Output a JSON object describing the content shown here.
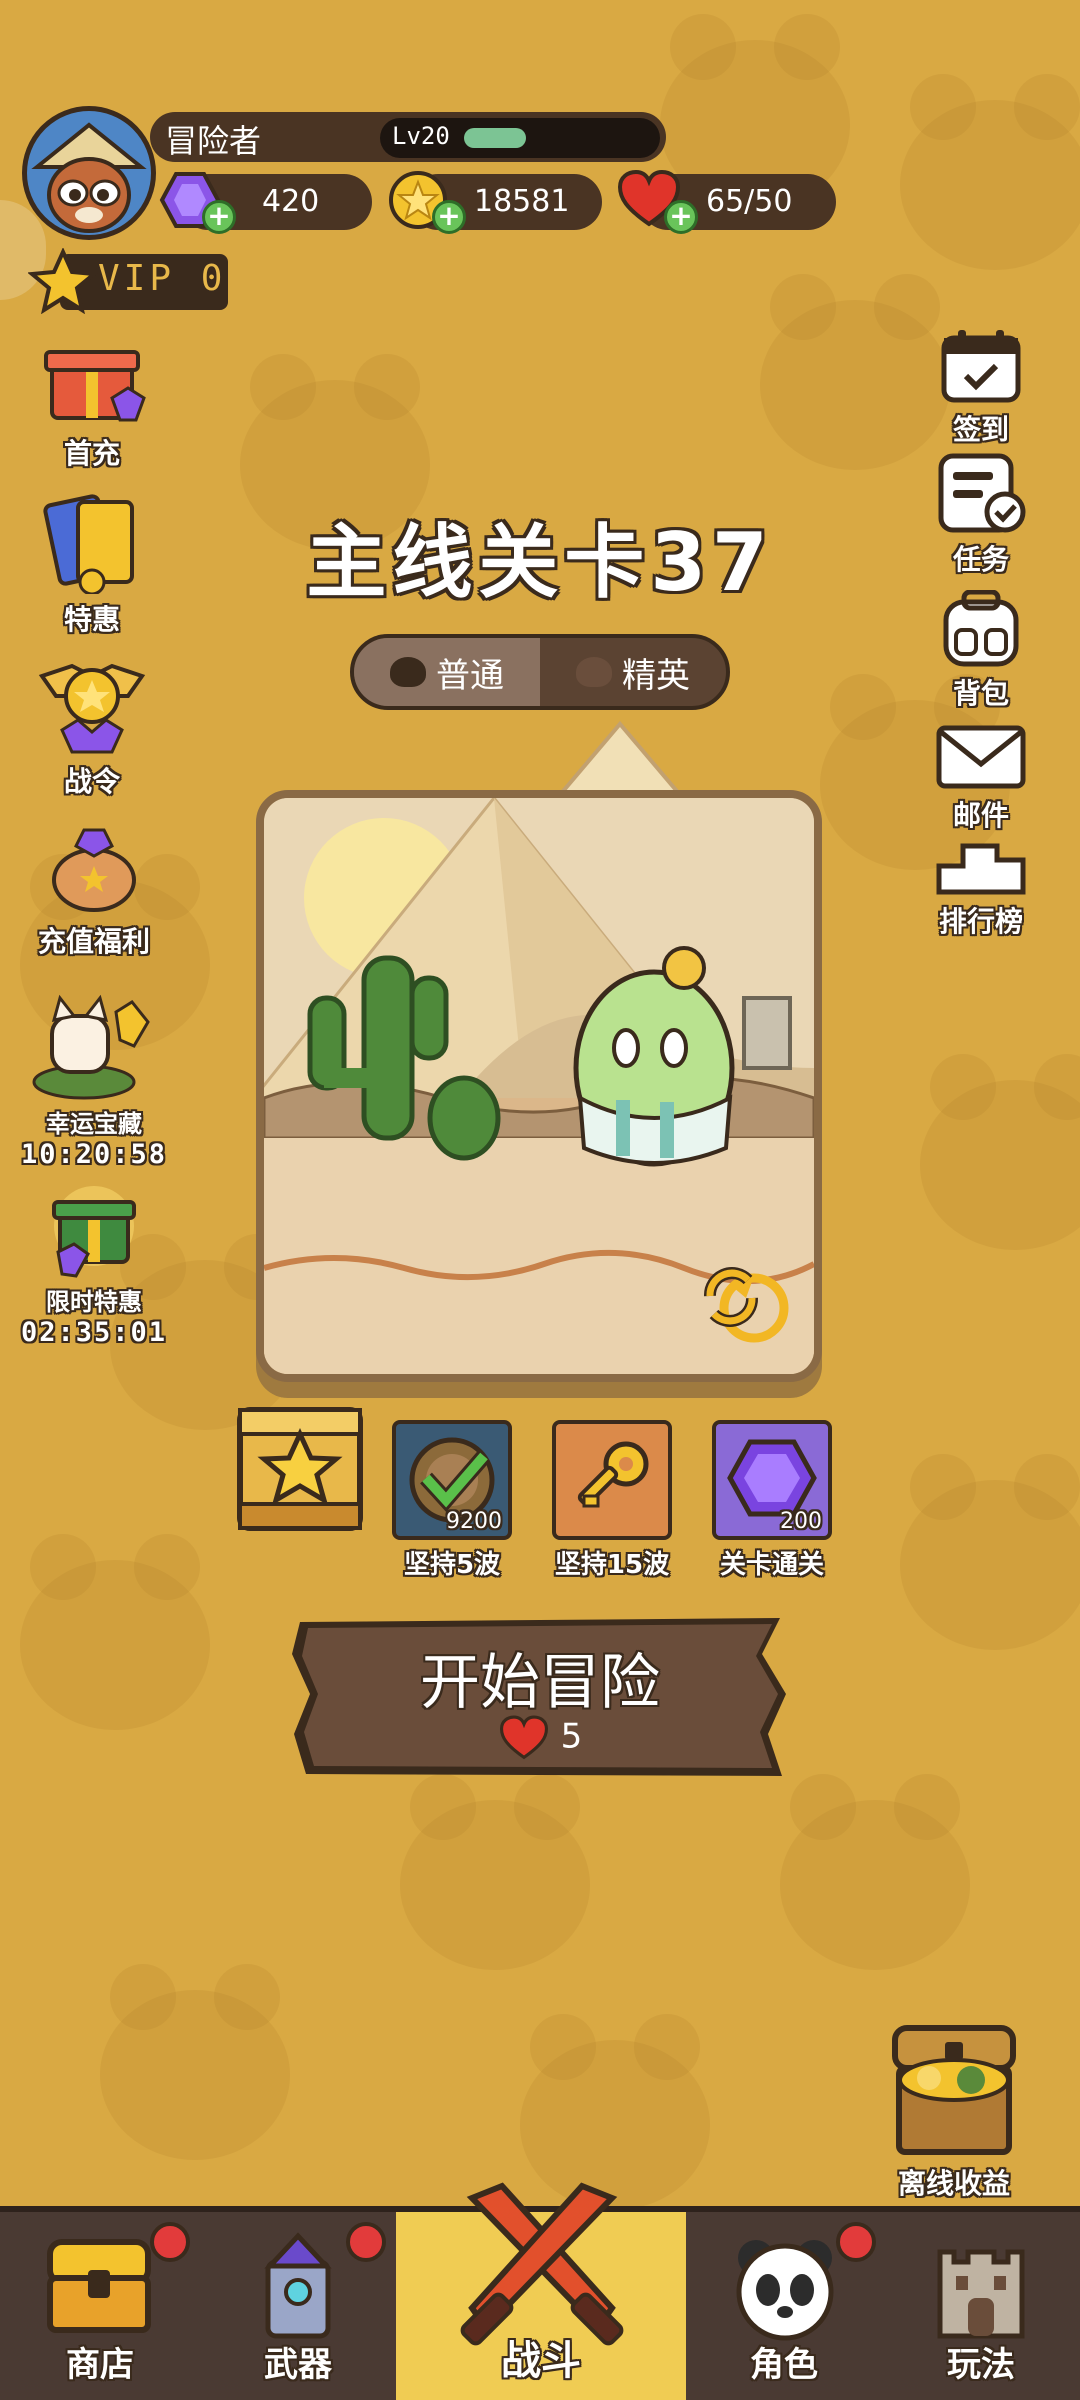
{
  "player": {
    "name": "冒险者",
    "level": "Lv20",
    "xp_fraction": 0.2,
    "vip": "VIP 0"
  },
  "currencies": {
    "gems": "420",
    "coins": "18581",
    "hearts": "65/50"
  },
  "left_menu": {
    "first_recharge": "首充",
    "special_offer": "特惠",
    "battle_pass": "战令",
    "recharge_bonus": "充值福利",
    "lucky_treasure": "幸运宝藏",
    "lucky_timer": "10:20:58",
    "limited_offer": "限时特惠",
    "limited_timer": "02:35:01"
  },
  "right_menu": {
    "checkin": "签到",
    "tasks": "任务",
    "backpack": "背包",
    "mail": "邮件",
    "leaderboard": "排行榜"
  },
  "stage": {
    "title": "主线关卡37",
    "mode_normal": "普通",
    "mode_elite": "精英"
  },
  "rewards": {
    "wave5": "坚持5波",
    "wave5_count": "9200",
    "wave15": "坚持15波",
    "clear": "关卡通关",
    "clear_count": "200"
  },
  "start": {
    "label": "开始冒险",
    "cost": "5"
  },
  "offline": "离线收益",
  "nav": {
    "shop": "商店",
    "weapons": "武器",
    "battle": "战斗",
    "character": "角色",
    "gameplay": "玩法"
  },
  "colors": {
    "background": "#d9a943",
    "panel": "#4a3423",
    "accent": "#f0cc53",
    "notification": "#e23b3b"
  }
}
